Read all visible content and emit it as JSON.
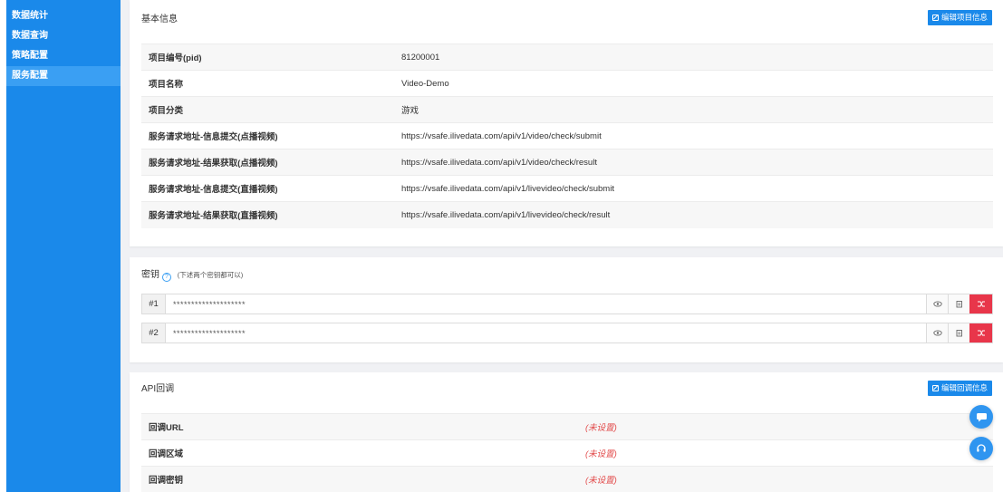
{
  "sidebar": {
    "items": [
      {
        "label": "数据统计"
      },
      {
        "label": "数据查询"
      },
      {
        "label": "策略配置"
      },
      {
        "label": "服务配置",
        "active": true
      }
    ]
  },
  "basic_info": {
    "title": "基本信息",
    "edit_button": "编辑项目信息",
    "rows": [
      {
        "key": "项目编号(pid)",
        "value": "81200001"
      },
      {
        "key": "项目名称",
        "value": "Video-Demo"
      },
      {
        "key": "项目分类",
        "value": "游戏"
      },
      {
        "key": "服务请求地址-信息提交(点播视频)",
        "value": "https://vsafe.ilivedata.com/api/v1/video/check/submit"
      },
      {
        "key": "服务请求地址-结果获取(点播视频)",
        "value": "https://vsafe.ilivedata.com/api/v1/video/check/result"
      },
      {
        "key": "服务请求地址-信息提交(直播视频)",
        "value": "https://vsafe.ilivedata.com/api/v1/livevideo/check/submit"
      },
      {
        "key": "服务请求地址-结果获取(直播视频)",
        "value": "https://vsafe.ilivedata.com/api/v1/livevideo/check/result"
      }
    ]
  },
  "secret": {
    "title": "密钥",
    "note": "(下述两个密钥都可以)",
    "keys": [
      {
        "prefix": "#1",
        "value": "********************"
      },
      {
        "prefix": "#2",
        "value": "********************"
      }
    ],
    "icons": {
      "view": "eye-icon",
      "copy": "copy-icon",
      "reset": "shuffle-icon"
    },
    "danger_color": "#e8364a"
  },
  "callback": {
    "title": "API回调",
    "edit_button": "编辑回调信息",
    "rows": [
      {
        "key": "回调URL",
        "value": "(未设置)"
      },
      {
        "key": "回调区域",
        "value": "(未设置)"
      },
      {
        "key": "回调密钥",
        "value": "(未设置)"
      }
    ]
  },
  "colors": {
    "accent": "#1a89ea",
    "unset": "#e24a4a"
  }
}
